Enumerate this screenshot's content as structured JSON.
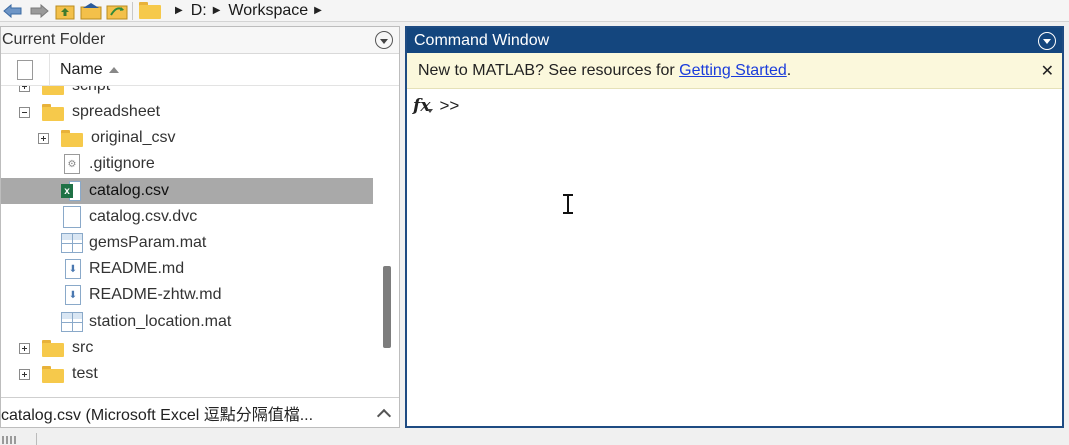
{
  "toolbar": {
    "buttons": [
      "back-arrow-icon",
      "forward-arrow-icon",
      "up-folder-icon",
      "browse-folder-icon",
      "refresh-folder-icon"
    ],
    "path": [
      "D:",
      "Workspace"
    ]
  },
  "current_folder": {
    "title": "Current Folder",
    "column_name": "Name",
    "items": [
      {
        "label": "script",
        "icon": "folder-icon",
        "toggle": "plus"
      },
      {
        "label": "spreadsheet",
        "icon": "folder-icon",
        "toggle": "minus"
      },
      {
        "label": "original_csv",
        "icon": "folder-icon",
        "toggle": "plus"
      },
      {
        "label": ".gitignore",
        "icon": "gitignore-file-icon"
      },
      {
        "label": "catalog.csv",
        "icon": "excel-csv-icon",
        "selected": true
      },
      {
        "label": "catalog.csv.dvc",
        "icon": "file-icon"
      },
      {
        "label": "gemsParam.mat",
        "icon": "mat-file-icon"
      },
      {
        "label": "README.md",
        "icon": "markdown-file-icon"
      },
      {
        "label": "README-zhtw.md",
        "icon": "markdown-file-icon"
      },
      {
        "label": "station_location.mat",
        "icon": "mat-file-icon"
      },
      {
        "label": "src",
        "icon": "folder-icon",
        "toggle": "plus"
      },
      {
        "label": "test",
        "icon": "folder-icon",
        "toggle": "plus"
      }
    ],
    "footer": "catalog.csv  (Microsoft Excel 逗點分隔值檔..."
  },
  "command_window": {
    "title": "Command Window",
    "notice_text": "New to MATLAB? See resources for ",
    "notice_link": "Getting Started",
    "notice_end": ".",
    "fx": "fx",
    "prompt": ">>"
  }
}
